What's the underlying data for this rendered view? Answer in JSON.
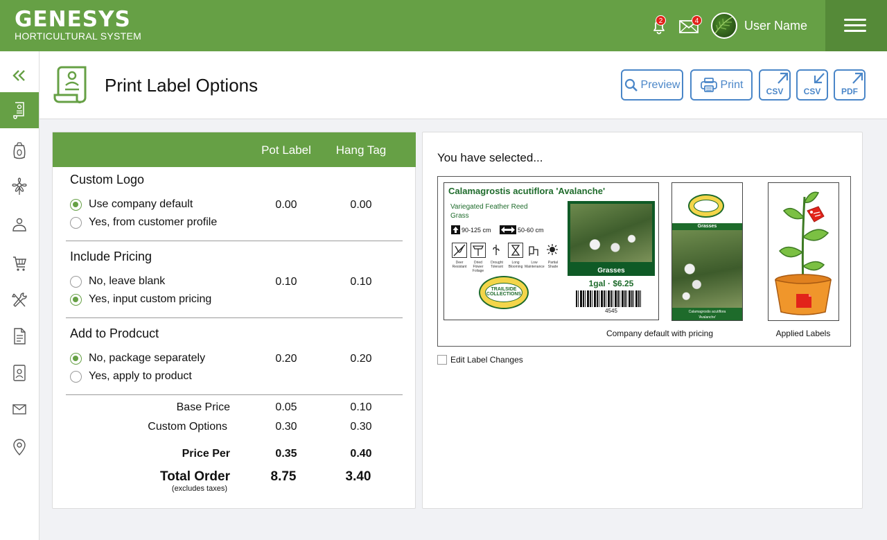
{
  "app": {
    "logo_main": "GENESYS",
    "logo_sub": "HORTICULTURAL SYSTEM",
    "notifications_count": "2",
    "messages_count": "4",
    "user_name": "User Name",
    "accent": "#66a045",
    "link_blue": "#4a86c8"
  },
  "sidebar": {
    "items": [
      {
        "icon": "double-chevron-left-icon"
      },
      {
        "icon": "label-scroll-icon",
        "active": true
      },
      {
        "icon": "seed-bag-icon"
      },
      {
        "icon": "flower-icon"
      },
      {
        "icon": "hand-plant-icon"
      },
      {
        "icon": "cart-icon"
      },
      {
        "icon": "tools-icon"
      },
      {
        "icon": "document-icon"
      },
      {
        "icon": "contact-card-icon"
      },
      {
        "icon": "envelope-icon"
      },
      {
        "icon": "location-pin-icon"
      }
    ]
  },
  "header": {
    "title": "Print Label Options",
    "preview_label": "Preview",
    "print_label": "Print",
    "csv_export_label": "CSV",
    "csv_import_label": "CSV",
    "pdf_label": "PDF"
  },
  "options": {
    "columns": [
      "Pot Label",
      "Hang Tag"
    ],
    "sections": [
      {
        "title": "Custom Logo",
        "options": [
          {
            "label": "Use company default",
            "checked": true,
            "pot": "0.00",
            "hang": "0.00"
          },
          {
            "label": "Yes, from customer profile",
            "checked": false
          }
        ]
      },
      {
        "title": "Include Pricing",
        "options": [
          {
            "label": "No, leave blank",
            "checked": false,
            "pot": "0.10",
            "hang": "0.10"
          },
          {
            "label": "Yes, input custom pricing",
            "checked": true
          }
        ]
      },
      {
        "title": "Add to Prodcuct",
        "options": [
          {
            "label": "No, package separately",
            "checked": true,
            "pot": "0.20",
            "hang": "0.20"
          },
          {
            "label": "Yes, apply to product",
            "checked": false
          }
        ]
      }
    ],
    "totals": {
      "base_price": {
        "label": "Base Price",
        "pot": "0.05",
        "hang": "0.10"
      },
      "custom_options": {
        "label": "Custom Options",
        "pot": "0.30",
        "hang": "0.30"
      },
      "price_per": {
        "label": "Price Per",
        "pot": "0.35",
        "hang": "0.40"
      },
      "total_order": {
        "label": "Total Order",
        "note": "(excludes taxes)",
        "pot": "8.75",
        "hang": "3.40"
      }
    }
  },
  "selection": {
    "title": "You have selected...",
    "pot_label": {
      "plant_name": "Calamagrostis acutiflora 'Avalanche'",
      "common_name_1": "Variegated Feather Reed",
      "common_name_2": "Grass",
      "height": "90-125 cm",
      "spread": "50-60 cm",
      "care_icons": [
        {
          "name": "deer-resistant-icon",
          "caption": "Deer Resistant"
        },
        {
          "name": "dried-flower-icon",
          "caption": "Dried Flower Foliage"
        },
        {
          "name": "drought-tolerant-icon",
          "caption": "Drought Tolerant"
        },
        {
          "name": "long-blooming-icon",
          "caption": "Long Blooming"
        },
        {
          "name": "low-maintenance-icon",
          "caption": "Low Maintenance"
        },
        {
          "name": "partial-shade-icon",
          "caption": "Partial Shade"
        }
      ],
      "category": "Grasses",
      "size": "1gal",
      "price": "$6.25",
      "sku": "4545",
      "brand_top": "TRAILSIDE",
      "brand_bottom": "COLLECTIONS"
    },
    "hang_tag": {
      "category": "Grasses",
      "plant_name": "Calamagrostis acutiflora",
      "cultivar": "'Avalanche'"
    },
    "caption_default": "Company default with pricing",
    "caption_applied": "Applied Labels",
    "edit_label": "Edit Label Changes"
  }
}
